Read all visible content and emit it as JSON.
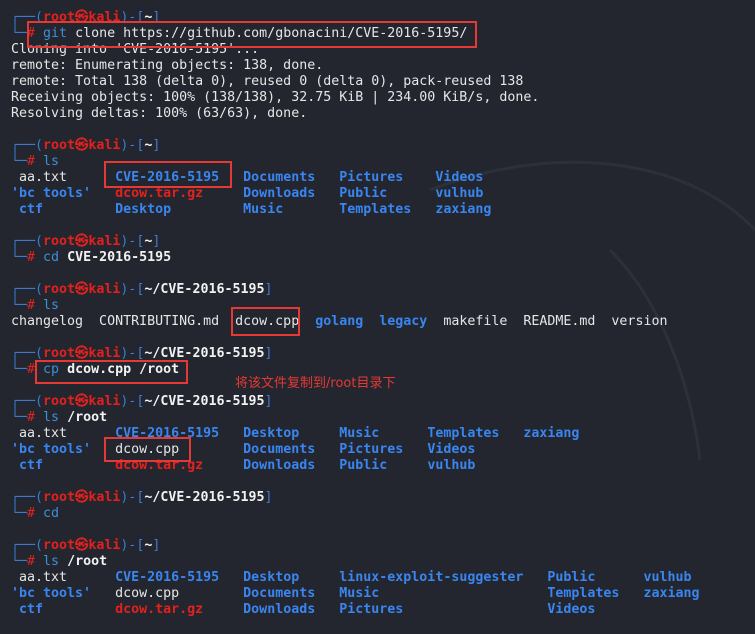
{
  "terminal": {
    "lines": [
      [
        [
          "┌──(",
          "f"
        ],
        [
          "root㉿kali",
          "r"
        ],
        [
          ")-[",
          "f"
        ],
        [
          "~",
          "w"
        ],
        [
          "]",
          "f"
        ]
      ],
      [
        [
          "└─",
          "f"
        ],
        [
          "# ",
          "h"
        ],
        [
          "git ",
          "c"
        ],
        [
          "clone https://github.com/gbonacini/CVE-2016-5195/",
          "t"
        ]
      ],
      [
        [
          "Cloning into 'CVE-2016-5195'...",
          "t"
        ]
      ],
      [
        [
          "remote: Enumerating objects: 138, done.",
          "t"
        ]
      ],
      [
        [
          "remote: Total 138 (delta 0), reused 0 (delta 0), pack-reused 138",
          "t"
        ]
      ],
      [
        [
          "Receiving objects: 100% (138/138), 32.75 KiB | 234.00 KiB/s, done.",
          "t"
        ]
      ],
      [
        [
          "Resolving deltas: 100% (63/63), done.",
          "t"
        ]
      ],
      [],
      [
        [
          "┌──(",
          "f"
        ],
        [
          "root㉿kali",
          "r"
        ],
        [
          ")-[",
          "f"
        ],
        [
          "~",
          "w"
        ],
        [
          "]",
          "f"
        ]
      ],
      [
        [
          "└─",
          "f"
        ],
        [
          "# ",
          "h"
        ],
        [
          "ls",
          "c"
        ]
      ],
      [
        [
          " aa.txt      ",
          "t"
        ],
        [
          "CVE-2016-5195   ",
          "d"
        ],
        [
          "Documents   ",
          "d"
        ],
        [
          "Pictures    ",
          "d"
        ],
        [
          "Videos",
          "d"
        ]
      ],
      [
        [
          "'bc tools'   ",
          "d"
        ],
        [
          "dcow.tar.gz     ",
          "z"
        ],
        [
          "Downloads   ",
          "d"
        ],
        [
          "Public      ",
          "d"
        ],
        [
          "vulhub",
          "d"
        ]
      ],
      [
        [
          " ctf         ",
          "d"
        ],
        [
          "Desktop         ",
          "d"
        ],
        [
          "Music       ",
          "d"
        ],
        [
          "Templates   ",
          "d"
        ],
        [
          "zaxiang",
          "d"
        ]
      ],
      [],
      [
        [
          "┌──(",
          "f"
        ],
        [
          "root㉿kali",
          "r"
        ],
        [
          ")-[",
          "f"
        ],
        [
          "~",
          "w"
        ],
        [
          "]",
          "f"
        ]
      ],
      [
        [
          "└─",
          "f"
        ],
        [
          "# ",
          "h"
        ],
        [
          "cd ",
          "c"
        ],
        [
          "CVE-2016-5195",
          "a"
        ]
      ],
      [],
      [
        [
          "┌──(",
          "f"
        ],
        [
          "root㉿kali",
          "r"
        ],
        [
          ")-[",
          "f"
        ],
        [
          "~/CVE-2016-5195",
          "w"
        ],
        [
          "]",
          "f"
        ]
      ],
      [
        [
          "└─",
          "f"
        ],
        [
          "# ",
          "h"
        ],
        [
          "ls",
          "c"
        ]
      ],
      [
        [
          "changelog  CONTRIBUTING.md  dcow.cpp  ",
          "t"
        ],
        [
          "golang  ",
          "d"
        ],
        [
          "legacy  ",
          "d"
        ],
        [
          "makefile  README.md  version",
          "t"
        ]
      ],
      [],
      [
        [
          "┌──(",
          "f"
        ],
        [
          "root㉿kali",
          "r"
        ],
        [
          ")-[",
          "f"
        ],
        [
          "~/CVE-2016-5195",
          "w"
        ],
        [
          "]",
          "f"
        ]
      ],
      [
        [
          "└─",
          "f"
        ],
        [
          "# ",
          "h"
        ],
        [
          "cp ",
          "c"
        ],
        [
          "dcow.cpp /root",
          "a"
        ]
      ],
      [],
      [
        [
          "┌──(",
          "f"
        ],
        [
          "root㉿kali",
          "r"
        ],
        [
          ")-[",
          "f"
        ],
        [
          "~/CVE-2016-5195",
          "w"
        ],
        [
          "]",
          "f"
        ]
      ],
      [
        [
          "└─",
          "f"
        ],
        [
          "# ",
          "h"
        ],
        [
          "ls ",
          "c"
        ],
        [
          "/root",
          "a"
        ]
      ],
      [
        [
          " aa.txt      ",
          "t"
        ],
        [
          "CVE-2016-5195   ",
          "d"
        ],
        [
          "Desktop     ",
          "d"
        ],
        [
          "Music      ",
          "d"
        ],
        [
          "Templates   ",
          "d"
        ],
        [
          "zaxiang",
          "d"
        ]
      ],
      [
        [
          "'bc tools'   ",
          "d"
        ],
        [
          "dcow.cpp        ",
          "t"
        ],
        [
          "Documents   ",
          "d"
        ],
        [
          "Pictures   ",
          "d"
        ],
        [
          "Videos",
          "d"
        ]
      ],
      [
        [
          " ctf         ",
          "d"
        ],
        [
          "dcow.tar.gz     ",
          "z"
        ],
        [
          "Downloads   ",
          "d"
        ],
        [
          "Public     ",
          "d"
        ],
        [
          "vulhub",
          "d"
        ]
      ],
      [],
      [
        [
          "┌──(",
          "f"
        ],
        [
          "root㉿kali",
          "r"
        ],
        [
          ")-[",
          "f"
        ],
        [
          "~/CVE-2016-5195",
          "w"
        ],
        [
          "]",
          "f"
        ]
      ],
      [
        [
          "└─",
          "f"
        ],
        [
          "# ",
          "h"
        ],
        [
          "cd",
          "c"
        ]
      ],
      [],
      [
        [
          "┌──(",
          "f"
        ],
        [
          "root㉿kali",
          "r"
        ],
        [
          ")-[",
          "f"
        ],
        [
          "~",
          "w"
        ],
        [
          "]",
          "f"
        ]
      ],
      [
        [
          "└─",
          "f"
        ],
        [
          "# ",
          "h"
        ],
        [
          "ls ",
          "c"
        ],
        [
          "/root",
          "a"
        ]
      ],
      [
        [
          " aa.txt      ",
          "t"
        ],
        [
          "CVE-2016-5195   ",
          "d"
        ],
        [
          "Desktop     ",
          "d"
        ],
        [
          "linux-exploit-suggester   ",
          "d"
        ],
        [
          "Public      ",
          "d"
        ],
        [
          "vulhub",
          "d"
        ]
      ],
      [
        [
          "'bc tools'   ",
          "d"
        ],
        [
          "dcow.cpp        ",
          "t"
        ],
        [
          "Documents   ",
          "d"
        ],
        [
          "Music                     ",
          "d"
        ],
        [
          "Templates   ",
          "d"
        ],
        [
          "zaxiang",
          "d"
        ]
      ],
      [
        [
          " ctf         ",
          "d"
        ],
        [
          "dcow.tar.gz     ",
          "z"
        ],
        [
          "Downloads   ",
          "d"
        ],
        [
          "Pictures                  ",
          "d"
        ],
        [
          "Videos",
          "d"
        ]
      ]
    ]
  },
  "annotation": {
    "note": "将该文件复制到/root目录下"
  },
  "colors": {
    "background": "#23262f",
    "highlight_box": "#e53935",
    "directory": "#3a86f0",
    "prompt_user": "#e3211d"
  }
}
